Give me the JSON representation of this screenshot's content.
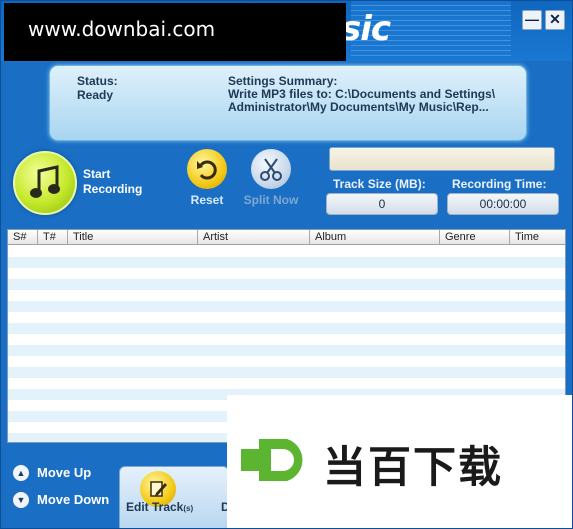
{
  "app": {
    "title_fragment": "sic",
    "minimize_label": "—",
    "close_label": "✕"
  },
  "watermark_top": {
    "text": "www.downbai.com"
  },
  "status_panel": {
    "status_label": "Status:",
    "status_value": "Ready",
    "summary_label": "Settings Summary:",
    "summary_value": "Write MP3 files to: C:\\Documents and Settings\\ Administrator\\My Documents\\My Music\\Rep..."
  },
  "controls": {
    "record_label": "Start Recording",
    "reset_label": "Reset",
    "split_label": "Split Now",
    "track_size_label": "Track Size (MB):",
    "track_size_value": "0",
    "recording_time_label": "Recording Time:",
    "recording_time_value": "00:00:00"
  },
  "table": {
    "columns": [
      "S#",
      "T#",
      "Title",
      "Artist",
      "Album",
      "Genre",
      "Time"
    ]
  },
  "footer": {
    "move_up_label": "Move Up",
    "move_down_label": "Move Down",
    "edit_label": "Edit Track",
    "edit_suffix": "(s)",
    "next_button_fragment": "D"
  },
  "watermark_bottom": {
    "text": "当百下载"
  },
  "colors": {
    "app_background": "#1a6fc4",
    "record_button": "#c4e82a",
    "reset_button": "#f3c916",
    "table_stripe": "#e4f2fc",
    "logo_green": "#5cb531"
  },
  "icons": {
    "record": "music-note-icon",
    "reset": "undo-arrow-icon",
    "split": "scissors-icon",
    "move_up": "arrow-up-icon",
    "move_down": "arrow-down-icon",
    "edit": "edit-pencil-icon",
    "watermark_logo": "downbai-logo-icon"
  }
}
